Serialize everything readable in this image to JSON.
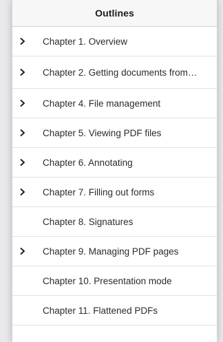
{
  "header": {
    "title": "Outlines"
  },
  "outline": {
    "items": [
      {
        "label": "Chapter 1. Overview",
        "expandable": true
      },
      {
        "label": "Chapter 2. Getting documents from…",
        "expandable": true
      },
      {
        "label": "Chapter 4. File management",
        "expandable": true
      },
      {
        "label": "Chapter 5. Viewing PDF files",
        "expandable": true
      },
      {
        "label": "Chapter 6. Annotating",
        "expandable": true
      },
      {
        "label": "Chapter 7. Filling out forms",
        "expandable": true
      },
      {
        "label": "Chapter 8. Signatures",
        "expandable": false
      },
      {
        "label": "Chapter 9. Managing PDF pages",
        "expandable": true
      },
      {
        "label": "Chapter 10. Presentation mode",
        "expandable": false
      },
      {
        "label": "Chapter 11. Flattened PDFs",
        "expandable": false
      }
    ]
  },
  "icons": {
    "expand": "chevron-right-icon"
  },
  "colors": {
    "panel_background": "#ffffff",
    "header_background": "#f7f7f7",
    "text": "#2b2b2b",
    "divider": "#e2e2e4"
  }
}
